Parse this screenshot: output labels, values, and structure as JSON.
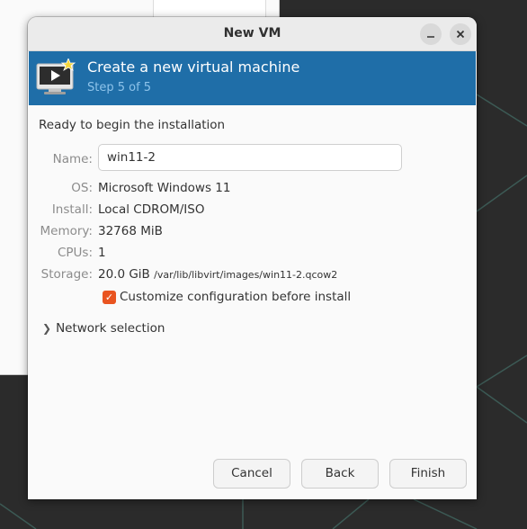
{
  "window": {
    "title": "New VM"
  },
  "banner": {
    "title": "Create a new virtual machine",
    "step": "Step 5 of 5"
  },
  "summary": {
    "heading": "Ready to begin the installation",
    "name_label": "Name:",
    "name_value": "win11-2",
    "os_label": "OS:",
    "os_value": "Microsoft Windows 11",
    "install_label": "Install:",
    "install_value": "Local CDROM/ISO",
    "memory_label": "Memory:",
    "memory_value": "32768 MiB",
    "cpus_label": "CPUs:",
    "cpus_value": "1",
    "storage_label": "Storage:",
    "storage_size": "20.0 GiB",
    "storage_path": "/var/lib/libvirt/images/win11-2.qcow2"
  },
  "options": {
    "customize_label": "Customize configuration before install",
    "customize_checked": true,
    "network_label": "Network selection"
  },
  "buttons": {
    "cancel": "Cancel",
    "back": "Back",
    "finish": "Finish"
  },
  "colors": {
    "banner": "#1f6ea8",
    "accent": "#e95420"
  },
  "icons": {
    "minimize": "minimize-icon",
    "close": "close-icon",
    "banner": "vm-monitor-icon",
    "expander": "chevron-right-icon"
  }
}
